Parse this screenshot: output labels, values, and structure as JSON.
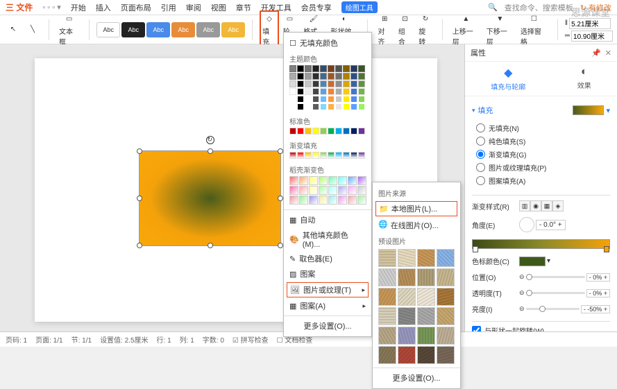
{
  "menubar": {
    "logo": "三 文件",
    "items": [
      "开始",
      "插入",
      "页面布局",
      "引用",
      "审阅",
      "视图",
      "章节",
      "开发工具",
      "会员专享"
    ],
    "tag": "绘图工具",
    "search_placeholder": "查找命令、搜索模板",
    "sync": "有修改"
  },
  "toolbar": {
    "textbox": "文本框",
    "shapes": {
      "s1": "Abc",
      "s2": "Abc",
      "s3": "Abc",
      "s4": "Abc",
      "s5": "Abc",
      "s6": "Abc"
    },
    "fill": "填充",
    "outline": "轮廓",
    "format_painter": "格式刷",
    "shape_effects": "形状效果",
    "align": "对齐",
    "group": "组合",
    "rotate": "旋转",
    "move_up": "上移一层",
    "move_down": "下移一层",
    "sel_pane": "选择窗格",
    "height": "5.21厘米",
    "width": "10.90厘米"
  },
  "fill_panel": {
    "no_fill": "无填充颜色",
    "theme_colors": "主题颜色",
    "standard_colors": "标准色",
    "gradient_fill": "渐变填充",
    "gradients_label": "稻壳渐变色",
    "auto": "自动",
    "more_colors": "其他填充颜色(M)...",
    "eyedropper": "取色器(E)",
    "pattern": "图案",
    "pic_texture": "图片或纹理(T)",
    "pattern_fill": "图案(A)",
    "more_settings": "更多设置(O)..."
  },
  "texture_panel": {
    "pic_source": "图片来源",
    "local_pic": "本地图片(L)...",
    "online_pic": "在线图片(O)...",
    "preset_pic": "预设图片",
    "more_settings": "更多设置(O)..."
  },
  "sidepanel": {
    "title": "属性",
    "tab_fill": "填充与轮廓",
    "tab_effect": "效果",
    "sec_fill": "填充",
    "opt_no_fill": "无填充(N)",
    "opt_solid": "纯色填充(S)",
    "opt_gradient": "渐变填充(G)",
    "opt_pic_texture": "图片或纹理填充(P)",
    "opt_pattern": "图案填充(A)",
    "grad_style": "渐变样式(R)",
    "angle": "角度(E)",
    "angle_val": "0.0°",
    "color_stop": "色标颜色(C)",
    "position": "位置(O)",
    "position_val": "0%",
    "transparency": "透明度(T)",
    "transparency_val": "0%",
    "brightness": "亮度(I)",
    "brightness_val": "-50%",
    "rotate_with_shape": "与形状一起旋转(W)"
  },
  "statusbar": {
    "page": "页码: 1",
    "pages": "页面: 1/1",
    "section": "节: 1/1",
    "pos": "设置值: 2.5厘米",
    "line": "行: 1",
    "col": "列: 1",
    "chars": "字数: 0",
    "spell": "拼写检查",
    "doc_check": "文档检查"
  },
  "watermark": "思源课堂"
}
